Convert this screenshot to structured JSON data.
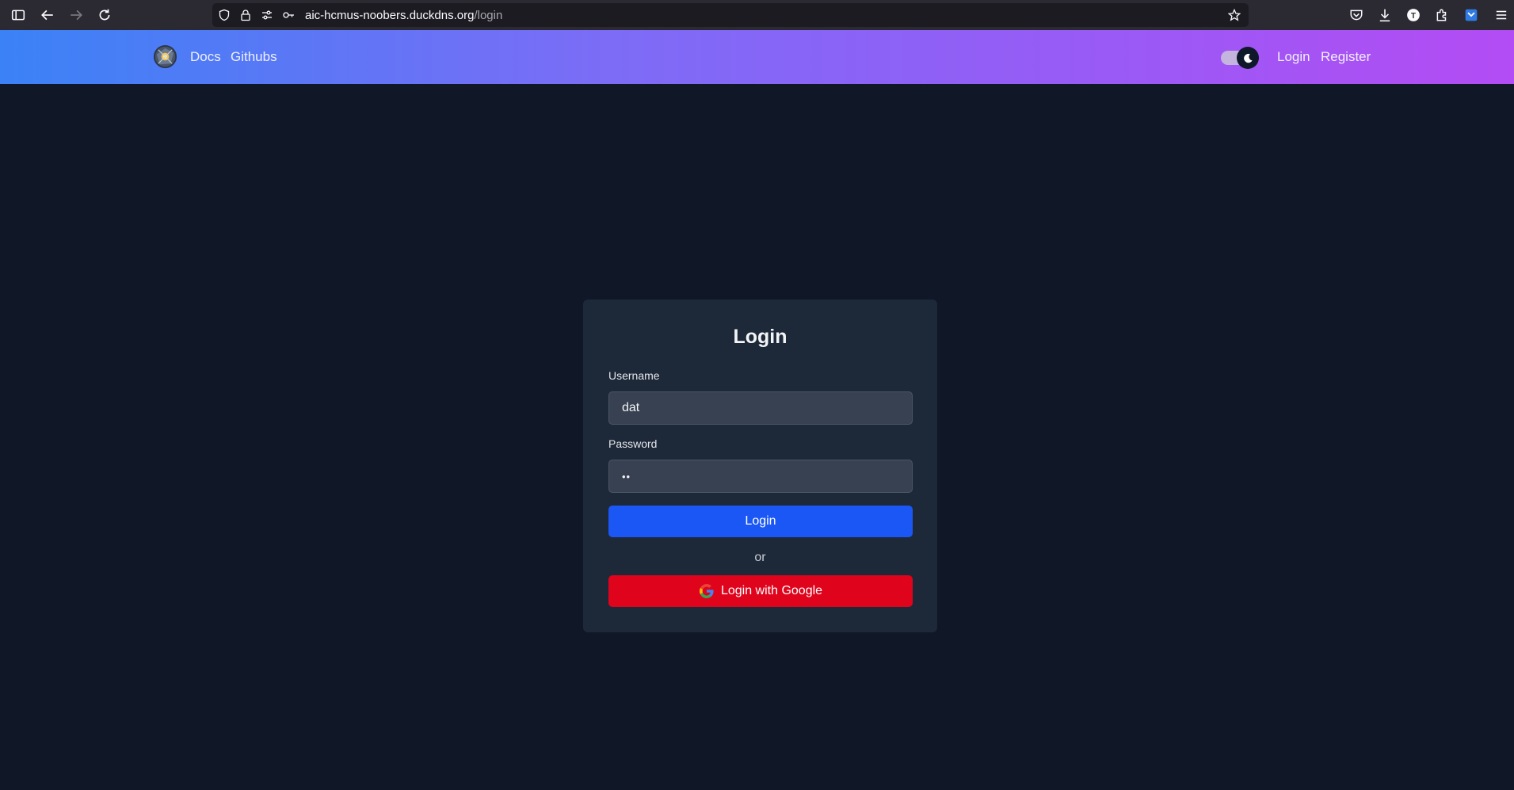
{
  "browser": {
    "url_host": "aic-hcmus-noobers.duckdns.org",
    "url_path": "/login",
    "icons": [
      "sidebar-icon",
      "back-icon",
      "forward-icon",
      "reload-icon",
      "shield-icon",
      "lock-icon",
      "permissions-icon",
      "key-icon",
      "bookmark-star-icon",
      "pocket-icon",
      "download-icon",
      "account-icon",
      "extensions-icon",
      "extension-badge-icon",
      "menu-icon"
    ]
  },
  "navbar": {
    "links": [
      "Docs",
      "Githubs"
    ],
    "login_label": "Login",
    "register_label": "Register",
    "theme": "dark"
  },
  "login_form": {
    "title": "Login",
    "username_label": "Username",
    "username_value": "dat",
    "password_label": "Password",
    "password_value": "••",
    "submit_label": "Login",
    "divider_text": "or",
    "google_label": "Login with Google"
  },
  "colors": {
    "page_bg": "#101727",
    "card_bg": "#1d2839",
    "primary_button": "#1a57f5",
    "google_button": "#e0031c"
  }
}
